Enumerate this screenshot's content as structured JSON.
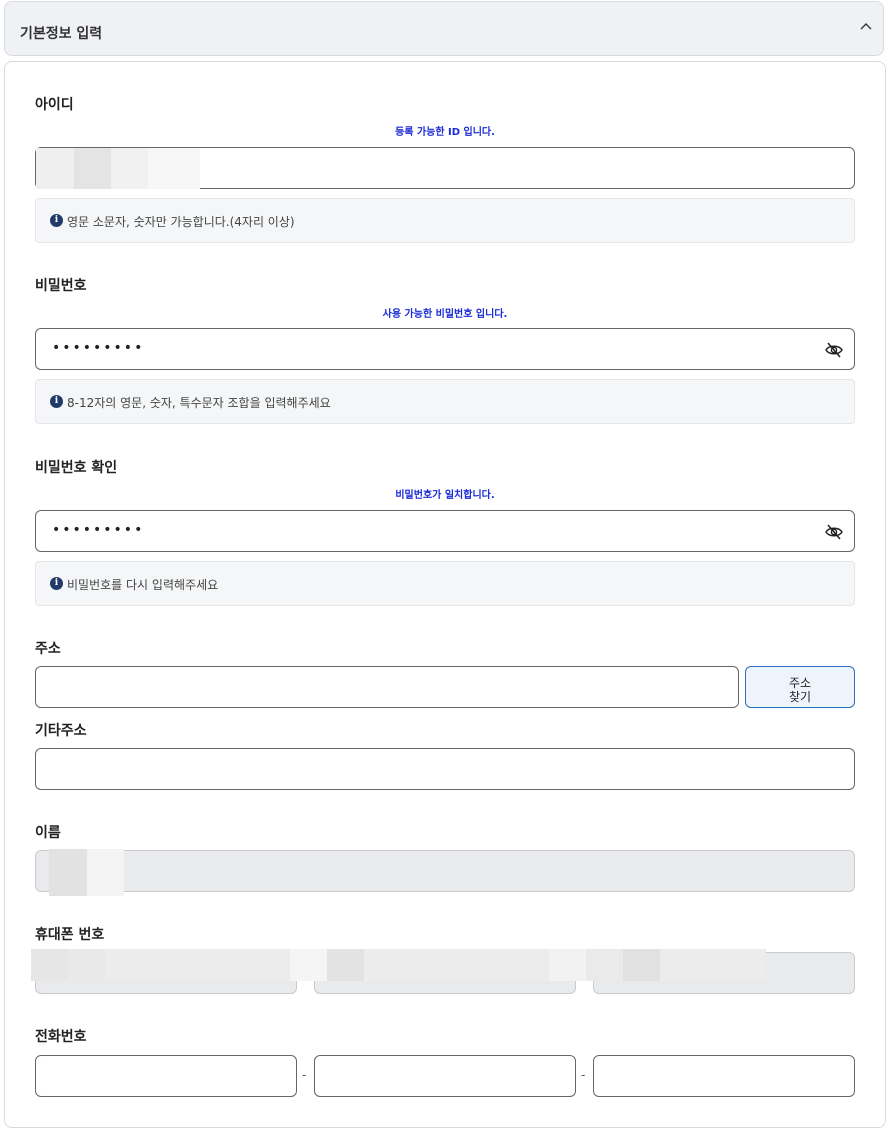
{
  "section": {
    "title": "기본정보 입력",
    "chevron_icon": "chevron-up-icon"
  },
  "userid": {
    "label": "아이디",
    "status": "등록 가능한 ID 입니다.",
    "hint": "영문 소문자, 숫자만 가능합니다.(4자리 이상)"
  },
  "password": {
    "label": "비밀번호",
    "status": "사용 가능한 비밀번호 입니다.",
    "value_masked": "•••••••••",
    "hint": "8-12자의 영문, 숫자, 특수문자 조합을 입력해주세요"
  },
  "password_confirm": {
    "label": "비밀번호 확인",
    "status": "비밀번호가 일치합니다.",
    "value_masked": "•••••••••",
    "hint": "비밀번호를 다시 입력해주세요"
  },
  "address": {
    "label": "주소",
    "search_button": "주소\n찾기"
  },
  "address_detail": {
    "label": "기타주소"
  },
  "name": {
    "label": "이름"
  },
  "mobile": {
    "label": "휴대폰 번호"
  },
  "phone": {
    "label": "전화번호",
    "separator": "-"
  },
  "colors": {
    "status_blue": "#1a2ad6",
    "button_border": "#2e6fbf",
    "info_icon": "#1f3a6b"
  }
}
